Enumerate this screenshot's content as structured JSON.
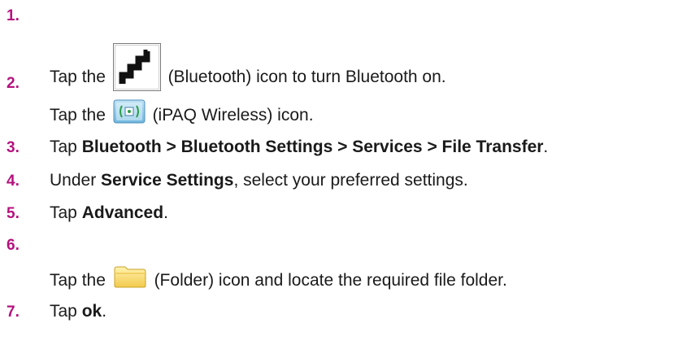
{
  "steps": [
    {
      "number": "1.",
      "pre": "Tap the ",
      "icon": "bluetooth-icon",
      "post": " (Bluetooth) icon to turn Bluetooth on."
    },
    {
      "number": "2.",
      "pre": "Tap the ",
      "icon": "ipaq-wireless-icon",
      "post": " (iPAQ Wireless) icon."
    },
    {
      "number": "3.",
      "pre": "Tap ",
      "bold": "Bluetooth > Bluetooth Settings > Services > File Transfer",
      "post": "."
    },
    {
      "number": "4.",
      "pre": "Under ",
      "bold": "Service Settings",
      "post": ", select your preferred settings."
    },
    {
      "number": "5.",
      "pre": "Tap ",
      "bold": "Advanced",
      "post": "."
    },
    {
      "number": "6.",
      "pre": "Tap the ",
      "icon": "folder-icon",
      "post": " (Folder) icon and locate the required file folder."
    },
    {
      "number": "7.",
      "pre": "Tap ",
      "bold": "ok",
      "post": "."
    }
  ],
  "colors": {
    "step_number": "#b5127e",
    "text": "#1a1a1a"
  }
}
